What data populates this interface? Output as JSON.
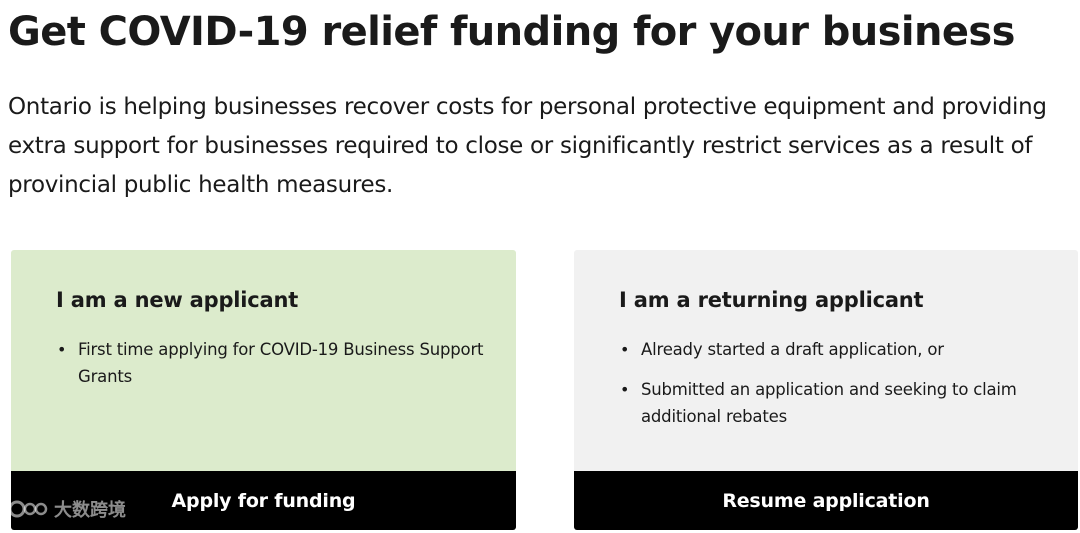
{
  "page": {
    "title": "Get COVID-19 relief funding for your business",
    "intro": "Ontario is helping businesses recover costs for personal protective equipment and providing extra support for businesses required to close or significantly restrict services as a result of provincial public health measures."
  },
  "cards": {
    "new_applicant": {
      "heading": "I am a new applicant",
      "items": [
        "First time applying for COVID-19 Business Support Grants"
      ],
      "button_label": "Apply for funding",
      "background": "#dcebcc"
    },
    "returning_applicant": {
      "heading": "I am a returning applicant",
      "items": [
        "Already started a draft application, or",
        "Submitted an application and seeking to claim additional rebates"
      ],
      "button_label": "Resume application",
      "background": "#f1f1f1"
    }
  },
  "watermark": {
    "text": "大数跨境",
    "icon": "watermark-logo-icon"
  },
  "colors": {
    "button_background": "#000000",
    "button_text": "#ffffff",
    "text": "#1a1a1a"
  }
}
